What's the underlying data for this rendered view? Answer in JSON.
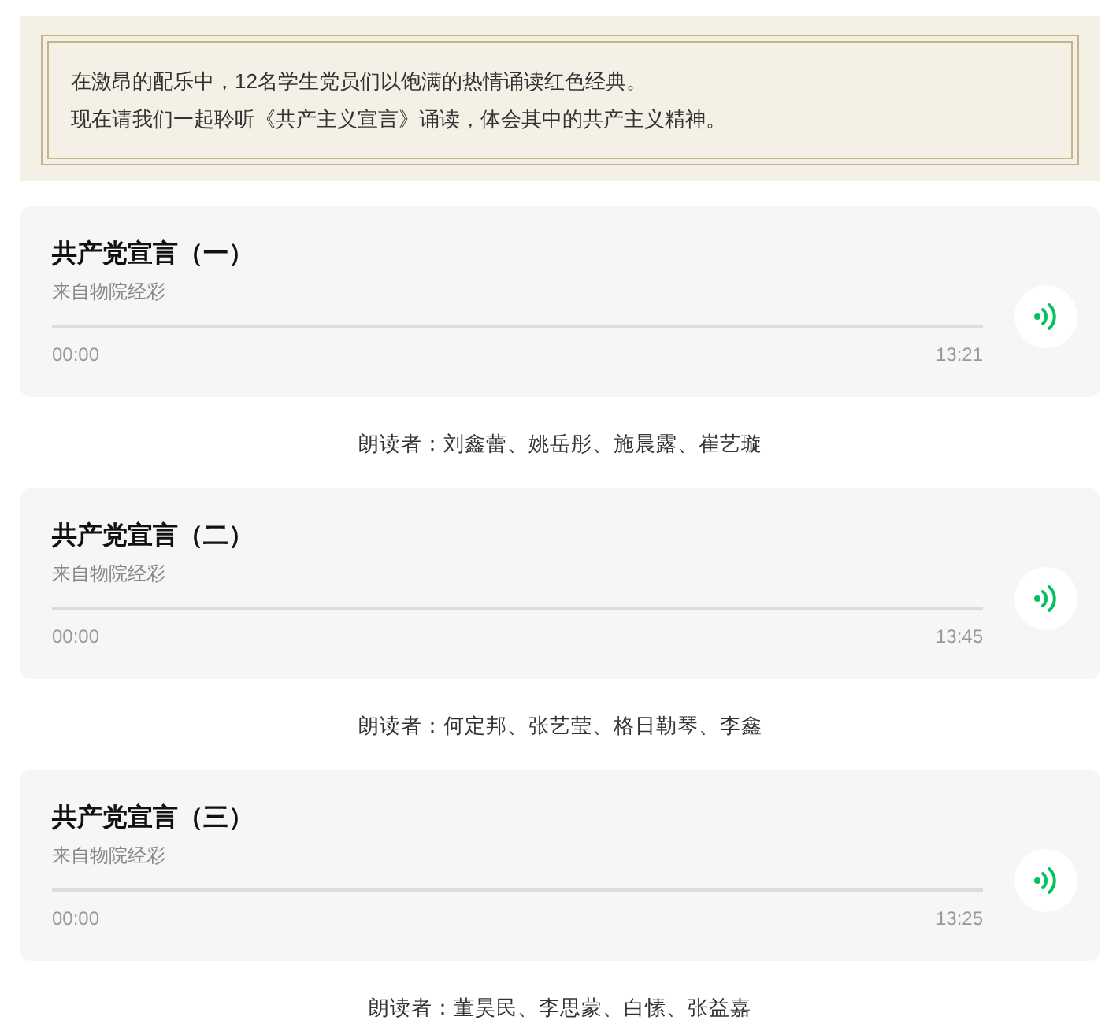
{
  "intro": {
    "lines": [
      "在激昂的配乐中，12名学生党员们以饱满的热情诵读红色经典。",
      "现在请我们一起聆听《共产主义宣言》诵读，体会其中的共产主义精神。"
    ]
  },
  "tracks": [
    {
      "title": "共产党宣言（一）",
      "source": "来自物院经彩",
      "current": "00:00",
      "duration": "13:21",
      "readers": "朗读者：刘鑫蕾、姚岳彤、施晨露、崔艺璇"
    },
    {
      "title": "共产党宣言（二）",
      "source": "来自物院经彩",
      "current": "00:00",
      "duration": "13:45",
      "readers": "朗读者：何定邦、张艺莹、格日勒琴、李鑫"
    },
    {
      "title": "共产党宣言（三）",
      "source": "来自物院经彩",
      "current": "00:00",
      "duration": "13:25",
      "readers": "朗读者：董昊民、李思蒙、白愫、张益嘉"
    }
  ]
}
